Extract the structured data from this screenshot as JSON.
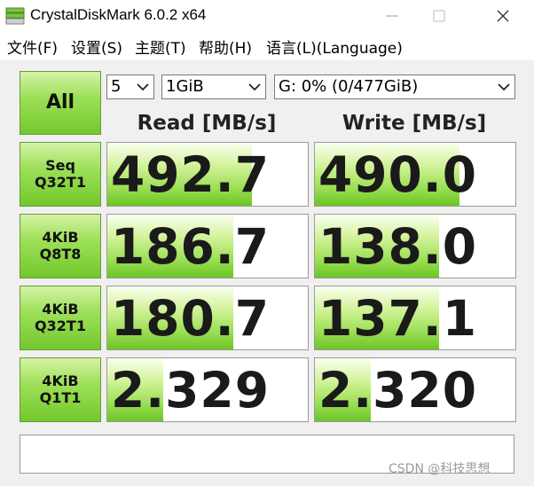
{
  "window": {
    "title": "CrystalDiskMark 6.0.2 x64"
  },
  "menu": [
    {
      "label": "文件(F)"
    },
    {
      "label": "设置(S)"
    },
    {
      "label": "主题(T)"
    },
    {
      "label": "帮助(H)"
    },
    {
      "label": "语言(L)(Language)"
    }
  ],
  "controls": {
    "all_label": "All",
    "count": "5",
    "size": "1GiB",
    "drive": "G: 0% (0/477GiB)"
  },
  "headers": {
    "read": "Read [MB/s]",
    "write": "Write [MB/s]"
  },
  "rows": [
    {
      "line1": "Seq",
      "line2": "Q32T1",
      "read": "492.7",
      "write": "490.0",
      "read_fill": 0.72,
      "write_fill": 0.72
    },
    {
      "line1": "4KiB",
      "line2": "Q8T8",
      "read": "186.7",
      "write": "138.0",
      "read_fill": 0.63,
      "write_fill": 0.62
    },
    {
      "line1": "4KiB",
      "line2": "Q32T1",
      "read": "180.7",
      "write": "137.1",
      "read_fill": 0.63,
      "write_fill": 0.62
    },
    {
      "line1": "4KiB",
      "line2": "Q1T1",
      "read": "2.329",
      "write": "2.320",
      "read_fill": 0.28,
      "write_fill": 0.28
    }
  ],
  "comment": "",
  "watermark": "CSDN @科技思想",
  "colors": {
    "accent_green": "#8cd84a",
    "background": "#f0f0f0"
  },
  "icons": {
    "app": "disk-icon",
    "minimize": "minimize-icon",
    "maximize": "maximize-icon",
    "close": "close-icon",
    "dropdown": "chevron-down-icon"
  }
}
